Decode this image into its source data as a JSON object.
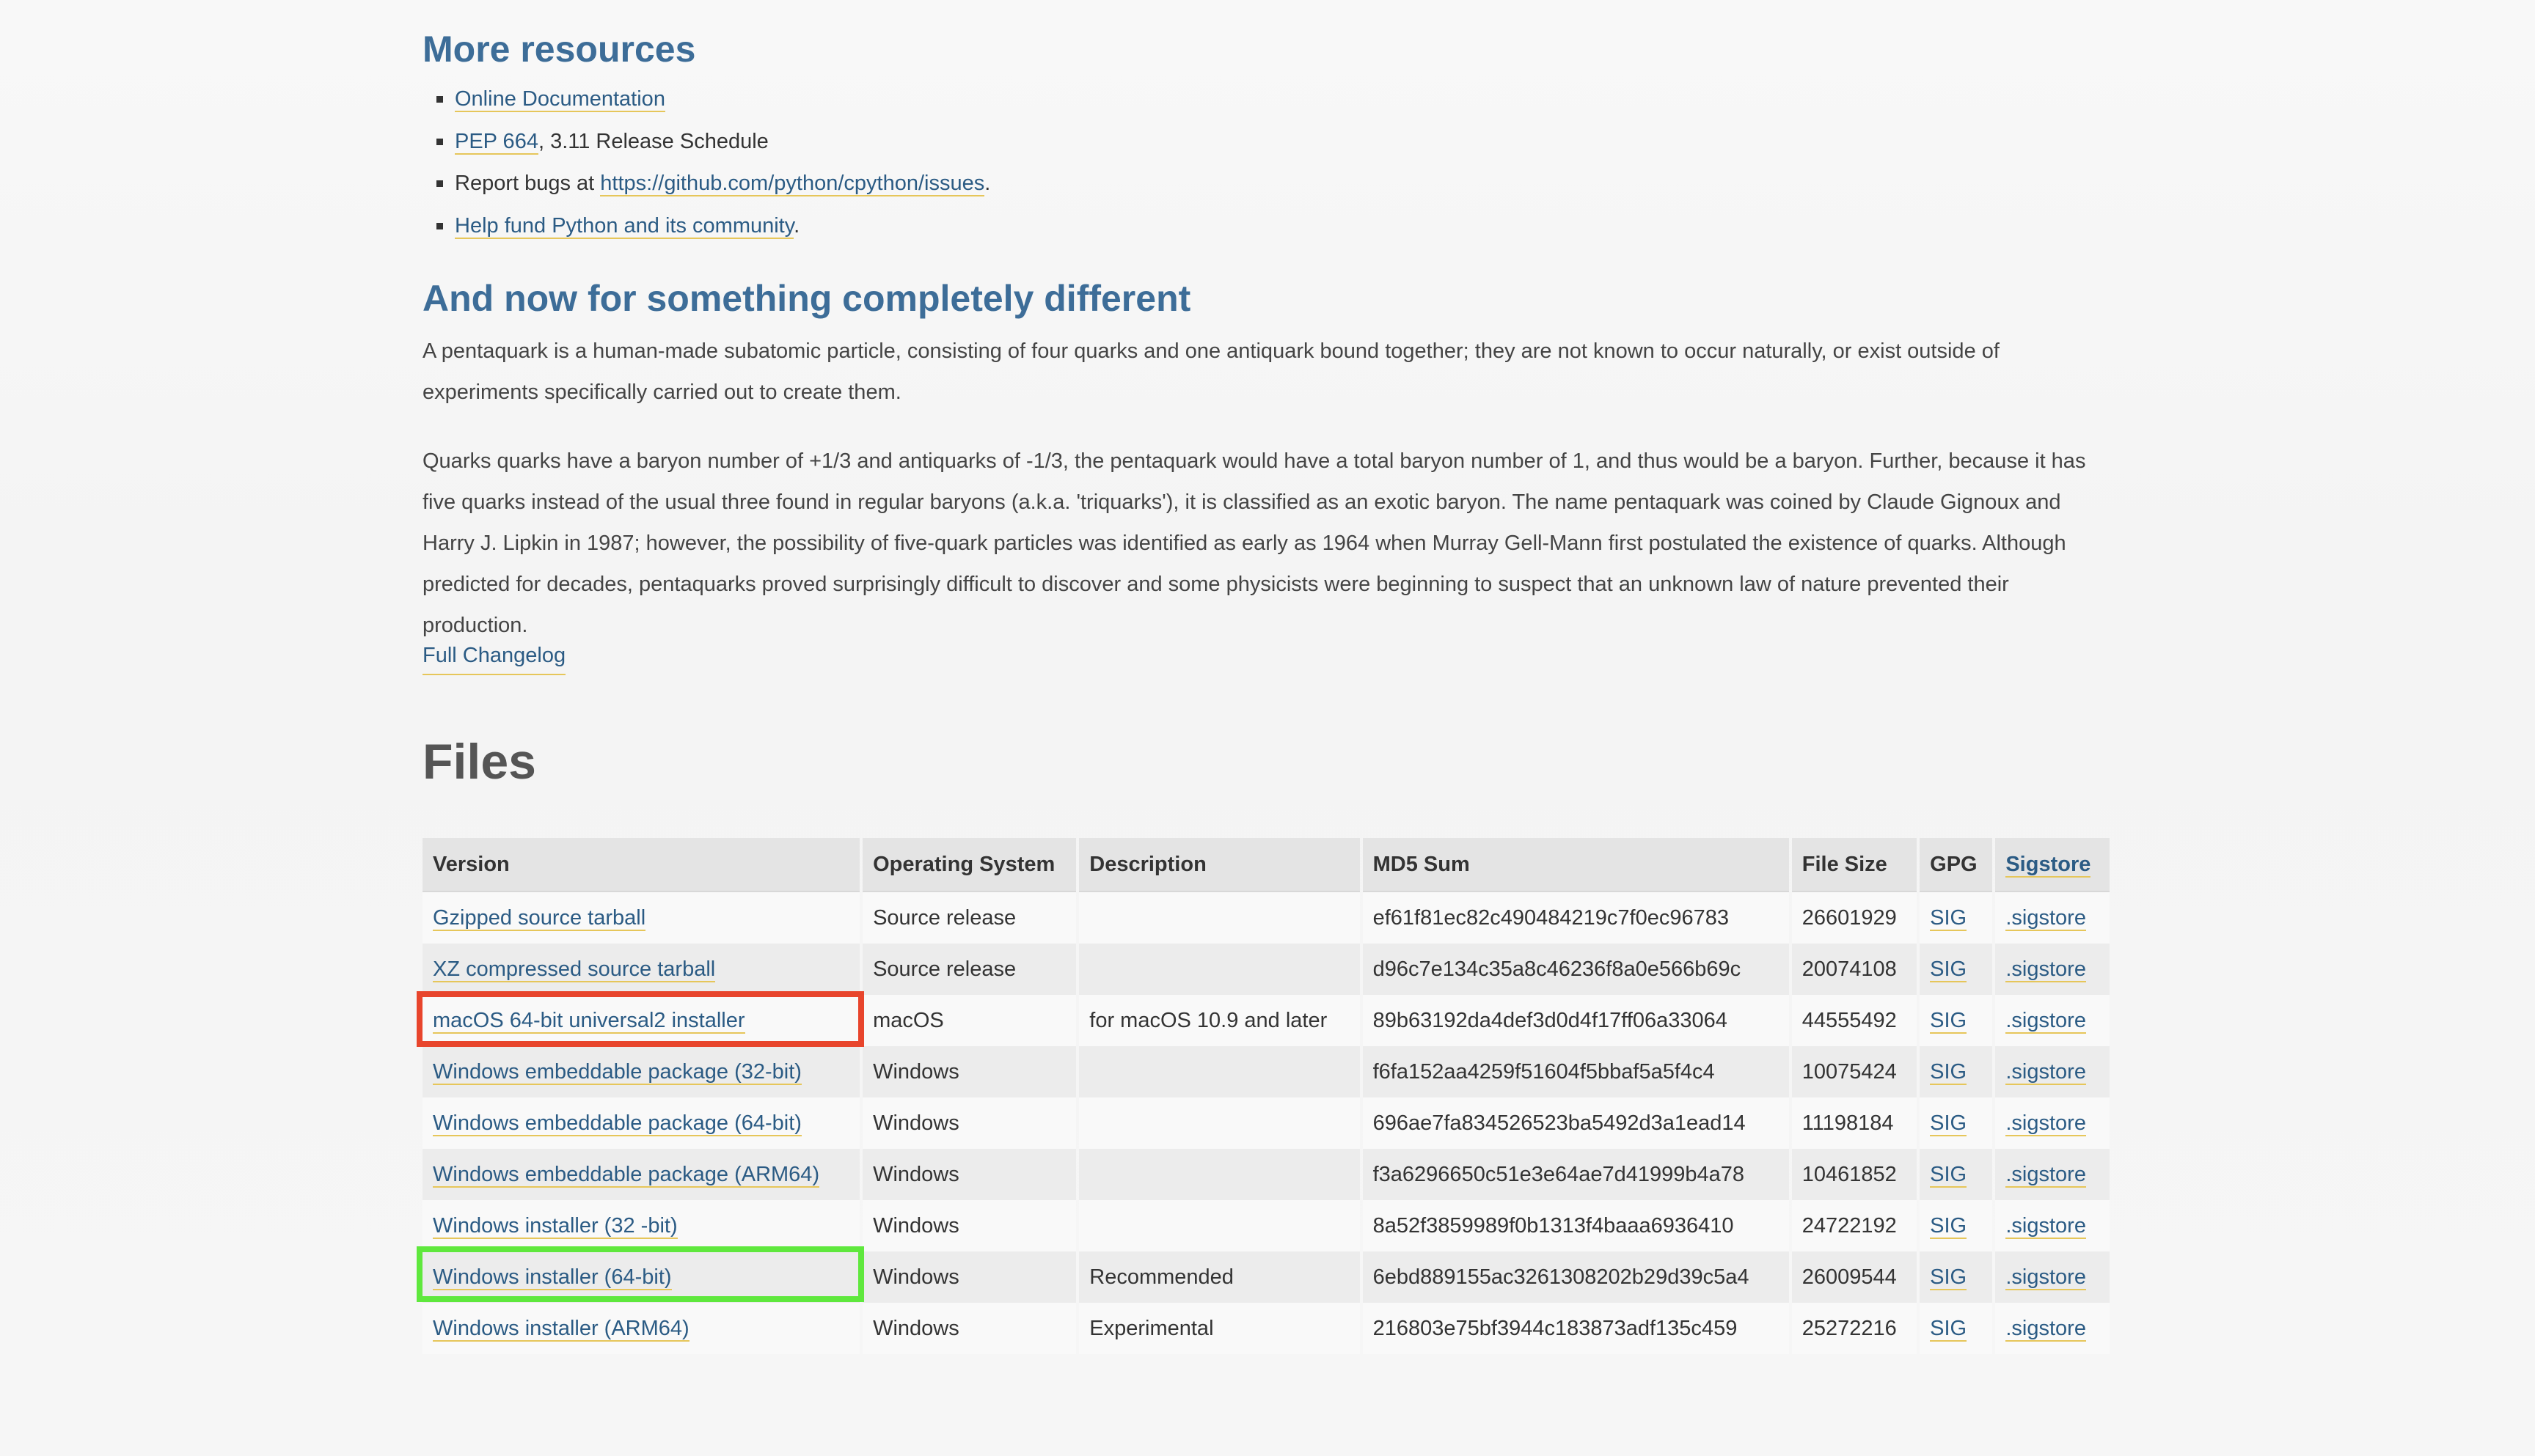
{
  "more_resources": {
    "heading": "More resources",
    "items": [
      {
        "link": "Online Documentation",
        "text_after": ""
      },
      {
        "link": "PEP 664",
        "text_after": ", 3.11 Release Schedule"
      },
      {
        "text_before": "Report bugs at ",
        "link": "https://github.com/python/cpython/issues",
        "text_after": "."
      },
      {
        "link": "Help fund Python and its community",
        "text_after": "."
      }
    ]
  },
  "different": {
    "heading": "And now for something completely different",
    "p1": "A pentaquark is a human-made subatomic particle, consisting of four quarks and one antiquark bound together; they are not known to occur naturally, or exist outside of experiments specifically carried out to create them.",
    "p2": "Quarks quarks have a baryon number of +1/3 and antiquarks of -1/3, the pentaquark would have a total baryon number of 1, and thus would be a baryon. Further, because it has five quarks instead of the usual three found in regular baryons (a.k.a. 'triquarks'), it is classified as an exotic baryon. The name pentaquark was coined by Claude Gignoux and Harry J. Lipkin in 1987; however, the possibility of five-quark particles was identified as early as 1964 when Murray Gell-Mann first postulated the existence of quarks. Although predicted for decades, pentaquarks proved surprisingly difficult to discover and some physicists were beginning to suspect that an unknown law of nature prevented their production.",
    "changelog": "Full Changelog"
  },
  "files": {
    "heading": "Files",
    "columns": [
      "Version",
      "Operating System",
      "Description",
      "MD5 Sum",
      "File Size",
      "GPG",
      "Sigstore"
    ],
    "rows": [
      {
        "version": "Gzipped source tarball",
        "os": "Source release",
        "desc": "",
        "md5": "ef61f81ec82c490484219c7f0ec96783",
        "size": "26601929",
        "gpg": "SIG",
        "sigstore": ".sigstore"
      },
      {
        "version": "XZ compressed source tarball",
        "os": "Source release",
        "desc": "",
        "md5": "d96c7e134c35a8c46236f8a0e566b69c",
        "size": "20074108",
        "gpg": "SIG",
        "sigstore": ".sigstore"
      },
      {
        "version": "macOS 64-bit universal2 installer",
        "os": "macOS",
        "desc": "for macOS 10.9 and later",
        "md5": "89b63192da4def3d0d4f17ff06a33064",
        "size": "44555492",
        "gpg": "SIG",
        "sigstore": ".sigstore"
      },
      {
        "version": "Windows embeddable package (32-bit)",
        "os": "Windows",
        "desc": "",
        "md5": "f6fa152aa4259f51604f5bbaf5a5f4c4",
        "size": "10075424",
        "gpg": "SIG",
        "sigstore": ".sigstore"
      },
      {
        "version": "Windows embeddable package (64-bit)",
        "os": "Windows",
        "desc": "",
        "md5": "696ae7fa834526523ba5492d3a1ead14",
        "size": "11198184",
        "gpg": "SIG",
        "sigstore": ".sigstore"
      },
      {
        "version": "Windows embeddable package (ARM64)",
        "os": "Windows",
        "desc": "",
        "md5": "f3a6296650c51e3e64ae7d41999b4a78",
        "size": "10461852",
        "gpg": "SIG",
        "sigstore": ".sigstore"
      },
      {
        "version": "Windows installer (32 -bit)",
        "os": "Windows",
        "desc": "",
        "md5": "8a52f3859989f0b1313f4baaa6936410",
        "size": "24722192",
        "gpg": "SIG",
        "sigstore": ".sigstore"
      },
      {
        "version": "Windows installer (64-bit)",
        "os": "Windows",
        "desc": "Recommended",
        "md5": "6ebd889155ac3261308202b29d39c5a4",
        "size": "26009544",
        "gpg": "SIG",
        "sigstore": ".sigstore"
      },
      {
        "version": "Windows installer (ARM64)",
        "os": "Windows",
        "desc": "Experimental",
        "md5": "216803e75bf3944c183873adf135c459",
        "size": "25272216",
        "gpg": "SIG",
        "sigstore": ".sigstore"
      }
    ]
  },
  "colors": {
    "heading_blue": "#3d6d98",
    "link": "#2b5b84",
    "link_underline": "#e6c65a",
    "highlight_red": "#e8452c",
    "highlight_green": "#5fe83d"
  }
}
